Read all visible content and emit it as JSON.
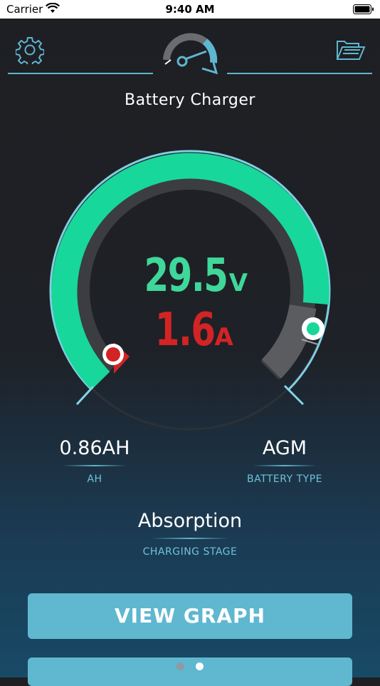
{
  "status_bar": {
    "carrier": "Carrier",
    "time": "9:40 AM"
  },
  "header": {
    "title": "Battery Charger",
    "settings_icon": "gear-icon",
    "logo_icon": "speedometer-logo-icon",
    "files_icon": "open-folder-icon"
  },
  "gauge": {
    "voltage": "29.5",
    "voltage_unit": "V",
    "current": "1.6",
    "current_unit": "A",
    "voltage_fill_fraction": 0.9,
    "current_fill_fraction": 0.06
  },
  "stats": {
    "ah_value": "0.86AH",
    "ah_label": "AH",
    "battery_type_value": "AGM",
    "battery_type_label": "BATTERY TYPE",
    "stage_value": "Absorption",
    "stage_label": "CHARGING STAGE"
  },
  "actions": {
    "view_graph_label": "VIEW GRAPH"
  },
  "pager": {
    "page_count": 2,
    "current_page": 2
  },
  "colors": {
    "voltage_green": "#3fd79a",
    "current_red": "#d22425",
    "accent_blue": "#5fb7d0",
    "track_gray": "#3c3d41"
  }
}
